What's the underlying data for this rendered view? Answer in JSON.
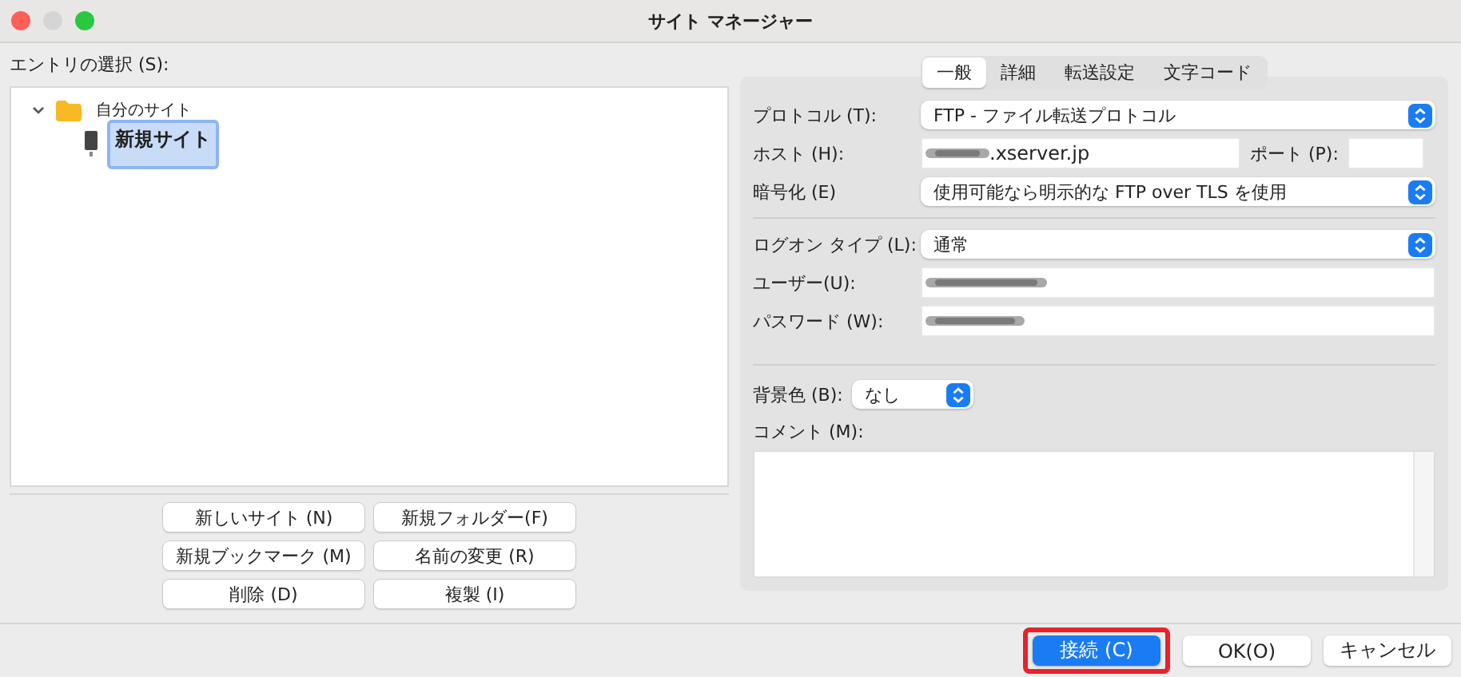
{
  "window": {
    "title": "サイト マネージャー"
  },
  "entry_label": "エントリの選択 (S):",
  "tree": [
    {
      "label": "自分のサイト",
      "kind": "folder",
      "expanded": true,
      "selected": false,
      "children": [
        {
          "label": "新規サイト",
          "kind": "site",
          "selected": true
        }
      ]
    }
  ],
  "site_buttons": [
    "新しいサイト (N)",
    "新規フォルダー(F)",
    "新規ブックマーク (M)",
    "名前の変更 (R)",
    "削除 (D)",
    "複製 (I)"
  ],
  "tabs": [
    {
      "label": "一般",
      "selected": true
    },
    {
      "label": "詳細",
      "selected": false
    },
    {
      "label": "転送設定",
      "selected": false
    },
    {
      "label": "文字コード",
      "selected": false
    }
  ],
  "protocol": {
    "label": "プロトコル (T):",
    "value": "FTP - ファイル転送プロトコル"
  },
  "host": {
    "label": "ホスト (H):",
    "value": ".xserver.jp",
    "blurred": true
  },
  "port": {
    "label": "ポート (P):"
  },
  "encryption": {
    "label": "暗号化 (E)",
    "value": "使用可能なら明示的な FTP over TLS を使用"
  },
  "logon_type": {
    "label": "ログオン タイプ (L):",
    "value": "通常"
  },
  "user": {
    "label": "ユーザー(U):",
    "blurred": true
  },
  "password": {
    "label": "パスワード (W):",
    "blurred": true
  },
  "background_color": {
    "label": "背景色 (B):",
    "value": "なし"
  },
  "comment": {
    "label": "コメント (M):"
  },
  "footer_buttons": [
    {
      "label": "接続 (C)",
      "kind": "primary",
      "highlighted": true
    },
    {
      "label": "OK(O)",
      "kind": "normal",
      "highlighted": false
    },
    {
      "label": "キャンセル",
      "kind": "normal",
      "highlighted": false
    }
  ]
}
